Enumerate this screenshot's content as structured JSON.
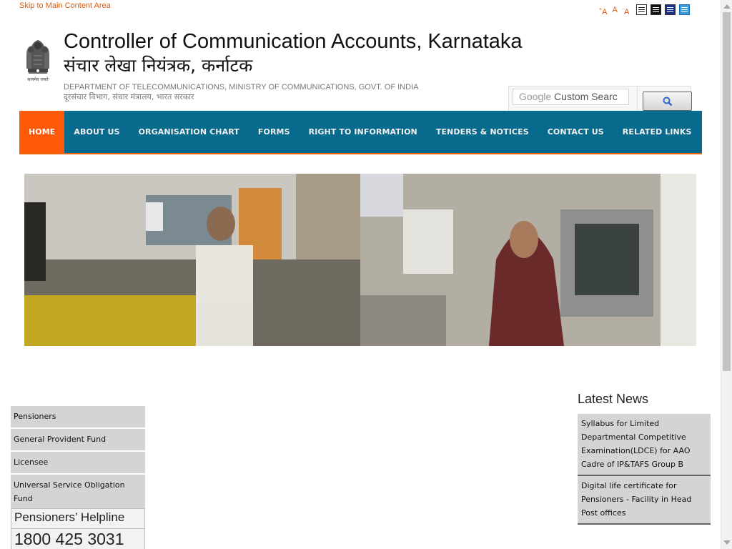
{
  "skip_link": "Skip to Main Content Area",
  "accessibility": {
    "font_increase": "A",
    "font_normal": "A",
    "font_decrease": "A",
    "font_increase_mark": "+",
    "font_decrease_mark": "-",
    "contrast_modes": [
      "standard",
      "black",
      "blue",
      "light-blue"
    ]
  },
  "header": {
    "title_en": "Controller of Communication Accounts, Karnataka",
    "title_hi": "संचार लेखा नियंत्रक, कर्नाटक",
    "dept_en": "DEPARTMENT OF TELECOMMUNICATIONS, MINISTRY OF COMMUNICATIONS, GOVT. OF INDIA",
    "dept_hi": "दूरसंचार विभाग, संचार मंत्रालय, भारत सरकार",
    "emblem_motto": "सत्यमेव जयते"
  },
  "search": {
    "placeholder": "Google Custom Search",
    "value": "Custom Searc",
    "brand": "Google",
    "icon": "magnifier-icon"
  },
  "nav": {
    "items": [
      {
        "label": "HOME",
        "active": true
      },
      {
        "label": "ABOUT US"
      },
      {
        "label": "ORGANISATION CHART"
      },
      {
        "label": "FORMS"
      },
      {
        "label": "RIGHT TO INFORMATION"
      },
      {
        "label": "TENDERS & NOTICES"
      },
      {
        "label": "CONTACT US"
      },
      {
        "label": "RELATED LINKS"
      }
    ]
  },
  "sidebar": {
    "items": [
      {
        "label": "Pensioners"
      },
      {
        "label": "General Provident Fund"
      },
      {
        "label": "Licensee"
      },
      {
        "label": "Universal Service Obligation Fund"
      }
    ],
    "helpline_title": "Pensioners’ Helpline",
    "helpline_number": "1800 425 3031"
  },
  "news": {
    "title": "Latest News",
    "items": [
      {
        "text": "Syllabus for Limited Departmental Competitive Examination(LDCE) for AAO Cadre of IP&TAFS Group B"
      },
      {
        "text": "Digital life certificate for Pensioners - Facility in Head Post offices"
      }
    ]
  },
  "colors": {
    "nav_bg": "#086a8c",
    "nav_active": "#ff5a0a",
    "accent_orange": "#e05a00",
    "panel_gray": "#d4d4d4"
  }
}
